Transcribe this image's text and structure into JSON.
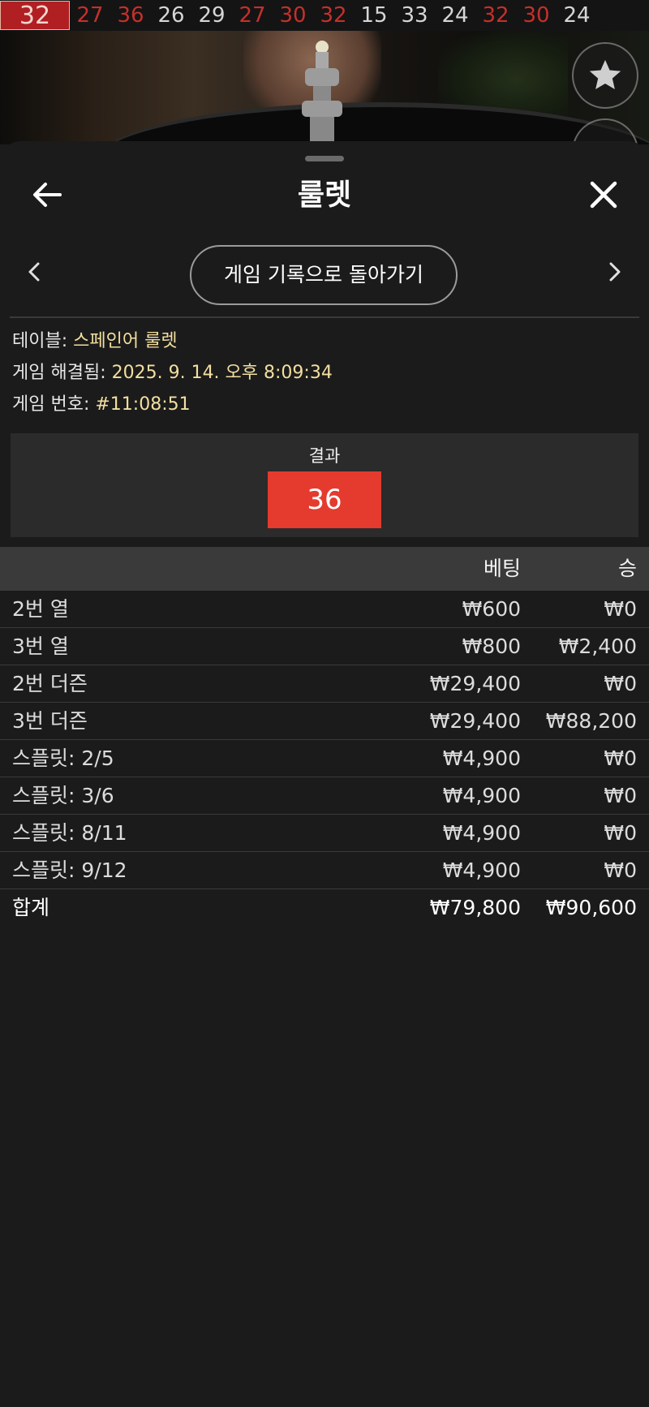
{
  "recent_results": [
    {
      "value": "32",
      "color": "#f4d6cf"
    },
    {
      "value": "27",
      "color": "#c4302b"
    },
    {
      "value": "36",
      "color": "#c4302b"
    },
    {
      "value": "26",
      "color": "#d6d6d6"
    },
    {
      "value": "29",
      "color": "#d6d6d6"
    },
    {
      "value": "27",
      "color": "#c4302b"
    },
    {
      "value": "30",
      "color": "#c4302b"
    },
    {
      "value": "32",
      "color": "#c4302b"
    },
    {
      "value": "15",
      "color": "#d6d6d6"
    },
    {
      "value": "33",
      "color": "#d6d6d6"
    },
    {
      "value": "24",
      "color": "#d6d6d6"
    },
    {
      "value": "32",
      "color": "#c4302b"
    },
    {
      "value": "30",
      "color": "#c4302b"
    },
    {
      "value": "24",
      "color": "#d6d6d6"
    }
  ],
  "header": {
    "title": "룰렛"
  },
  "navigation": {
    "back_to_history": "게임 기록으로 돌아가기"
  },
  "info": {
    "table_label": "테이블: ",
    "table_value": "스페인어 룰렛",
    "resolved_label": "게임 해결됨: ",
    "resolved_value": "2025. 9. 14. 오후 8:09:34",
    "game_no_label": "게임 번호: ",
    "game_no_value": "#11:08:51"
  },
  "result": {
    "label": "결과",
    "value": "36",
    "color": "#e43b2e"
  },
  "bets_table": {
    "columns": {
      "bet": "베팅",
      "win": "승"
    },
    "rows": [
      {
        "name": "2번 열",
        "bet": "₩600",
        "win": "₩0"
      },
      {
        "name": "3번 열",
        "bet": "₩800",
        "win": "₩2,400"
      },
      {
        "name": "2번 더즌",
        "bet": "₩29,400",
        "win": "₩0"
      },
      {
        "name": "3번 더즌",
        "bet": "₩29,400",
        "win": "₩88,200"
      },
      {
        "name": "스플릿: 2/5",
        "bet": "₩4,900",
        "win": "₩0"
      },
      {
        "name": "스플릿: 3/6",
        "bet": "₩4,900",
        "win": "₩0"
      },
      {
        "name": "스플릿: 8/11",
        "bet": "₩4,900",
        "win": "₩0"
      },
      {
        "name": "스플릿: 9/12",
        "bet": "₩4,900",
        "win": "₩0"
      }
    ],
    "total": {
      "name": "합계",
      "bet": "₩79,800",
      "win": "₩90,600"
    }
  },
  "icons": {
    "back": "arrow-left-icon",
    "close": "close-icon",
    "prev": "chevron-left-icon",
    "next": "chevron-right-icon",
    "favorite": "star-icon"
  }
}
